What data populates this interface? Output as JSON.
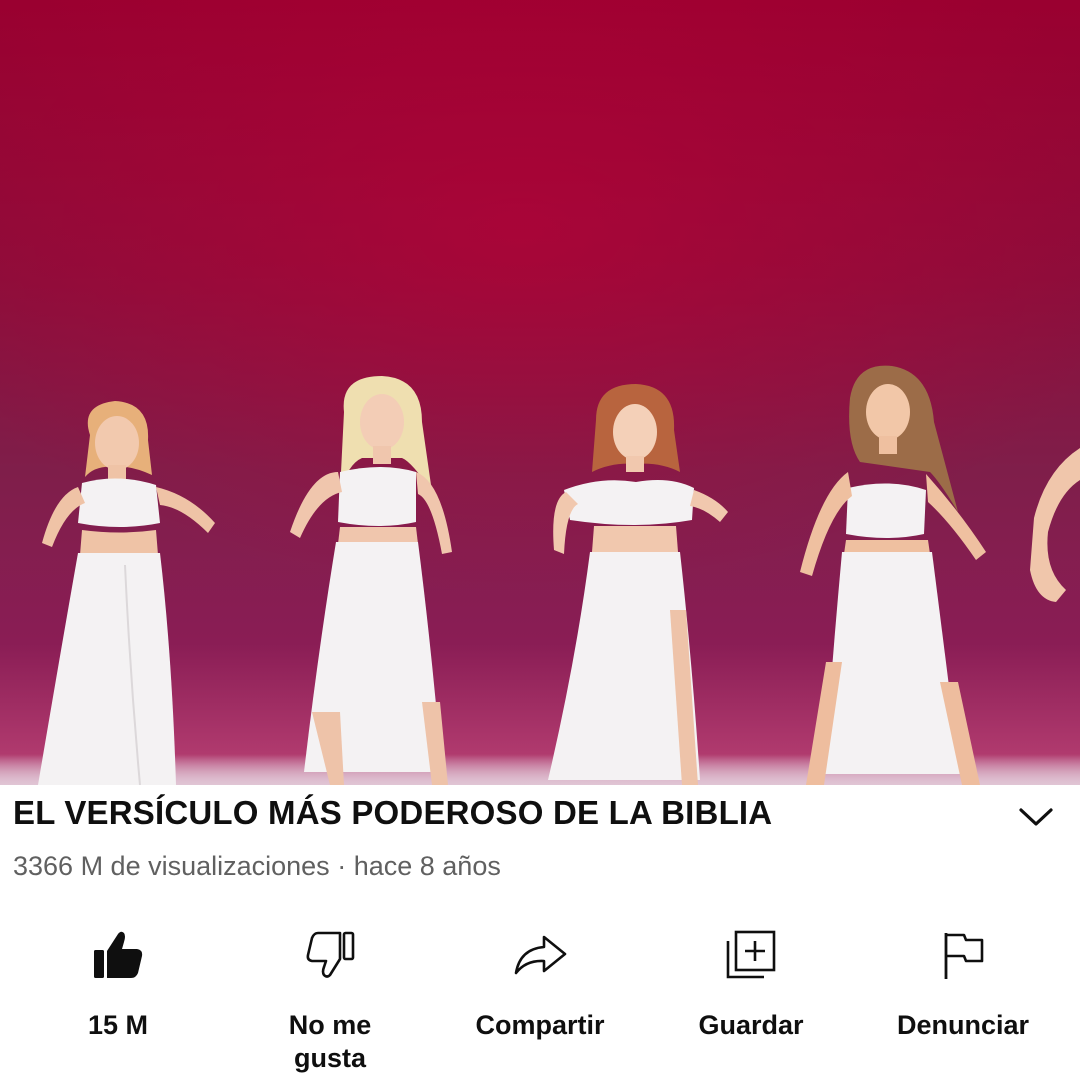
{
  "video": {
    "title": "EL VERSÍCULO MÁS PODEROSO DE LA BIBLIA",
    "views": "3366 M de visualizaciones",
    "separator": "·",
    "age": "hace 8 años"
  },
  "actions": {
    "like": {
      "label": "15 M",
      "icon": "thumbs-up-icon"
    },
    "dislike": {
      "label": "No me gusta",
      "icon": "thumbs-down-icon"
    },
    "share": {
      "label": "Compartir",
      "icon": "share-arrow-icon"
    },
    "save": {
      "label": "Guardar",
      "icon": "add-to-playlist-icon"
    },
    "report": {
      "label": "Denunciar",
      "icon": "flag-icon"
    }
  },
  "colors": {
    "background_top": "#9a0030",
    "background_bottom": "#8a1d55",
    "outfit": "#f4f2f3",
    "text_primary": "#0f0f0f",
    "text_secondary": "#606060"
  }
}
